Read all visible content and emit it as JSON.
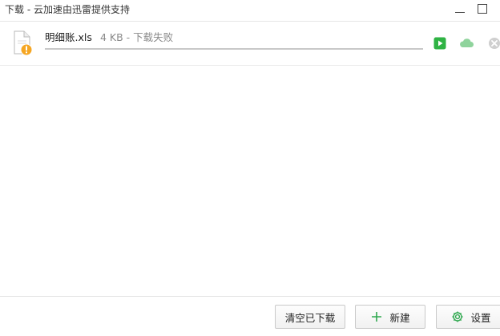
{
  "window": {
    "title": "下载 - 云加速由迅雷提供支持",
    "minimize_icon": "minimize-icon",
    "maximize_icon": "maximize-icon"
  },
  "download": {
    "file_name": "明细账.xls",
    "status": "4 KB - 下载失败",
    "file_icon": "file-warning-icon",
    "progress": 1.0,
    "actions": [
      {
        "name": "open",
        "icon": "play-icon",
        "color": "#2fb344"
      },
      {
        "name": "cloud",
        "icon": "cloud-icon",
        "color": "#8fd39c"
      },
      {
        "name": "delete",
        "icon": "close-circle-icon",
        "color": "#cfcfcf"
      }
    ]
  },
  "footer": {
    "clear_label": "清空已下载",
    "new_label": "新建",
    "new_icon": "plus-icon",
    "settings_label": "设置",
    "settings_icon": "gear-icon",
    "accent": "#2fa84f"
  }
}
